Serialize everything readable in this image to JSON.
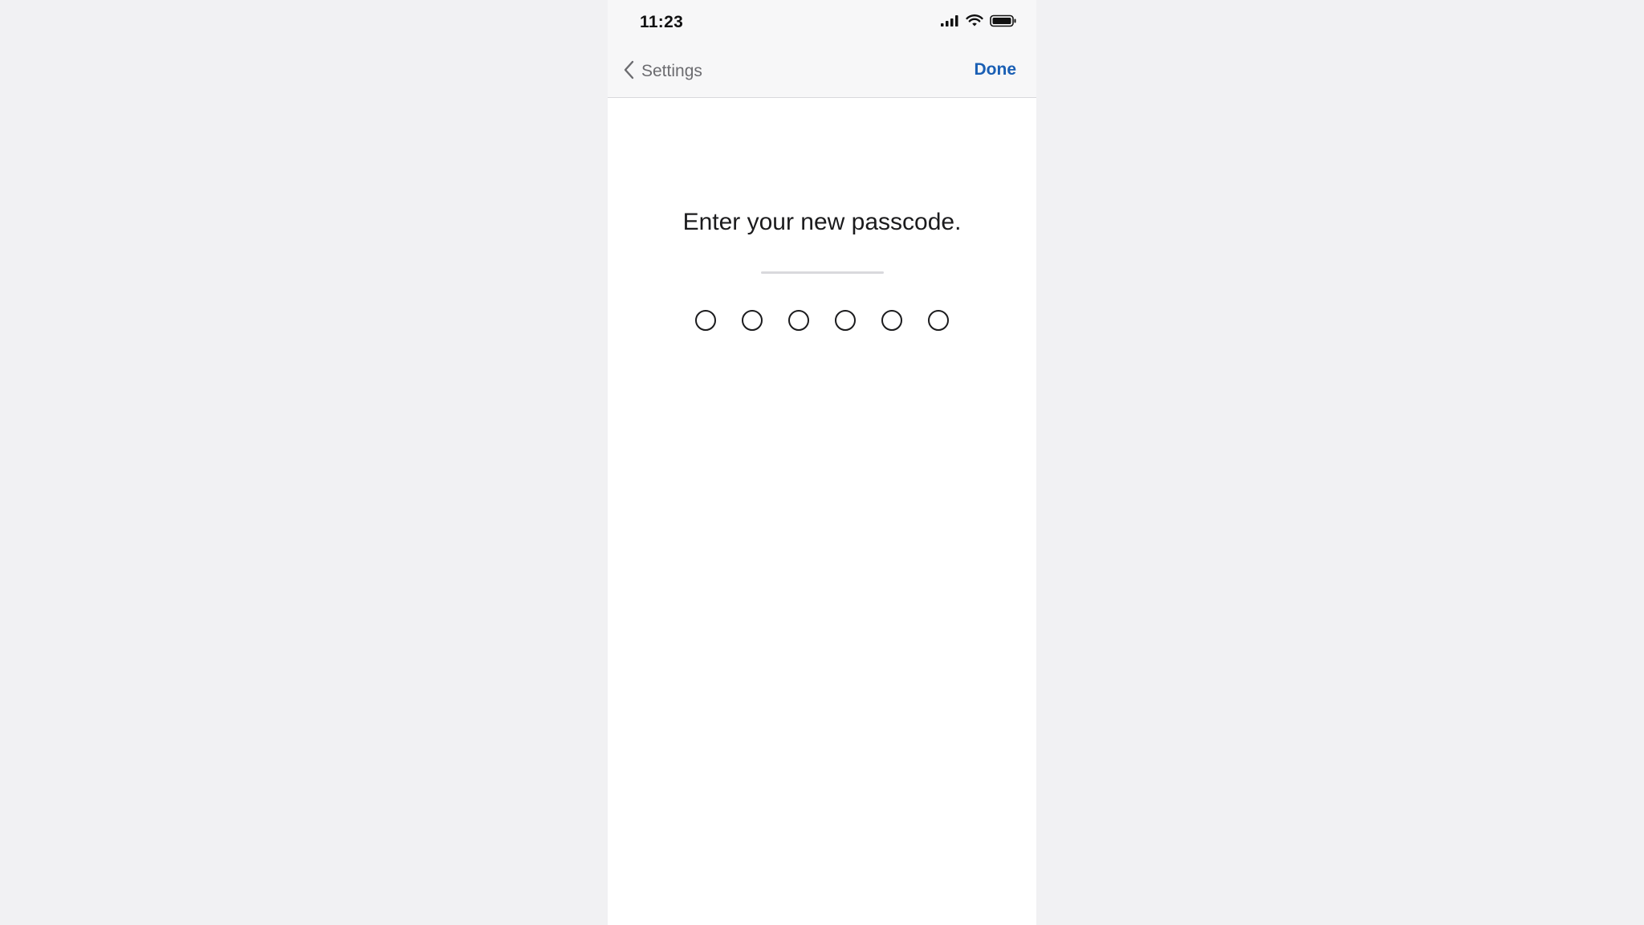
{
  "status_bar": {
    "time": "11:23",
    "icons": [
      "cellular-signal-icon",
      "wifi-icon",
      "battery-icon"
    ]
  },
  "nav": {
    "back_label": "Settings",
    "back_icon": "chevron-left-icon",
    "done_label": "Done"
  },
  "passcode": {
    "prompt": "Enter your new passcode.",
    "digit_count": 6,
    "entered_count": 0
  },
  "colors": {
    "accent": "#1a5fb4",
    "background": "#f1f1f3",
    "panel": "#ffffff",
    "nav_background": "#f7f7f8"
  }
}
